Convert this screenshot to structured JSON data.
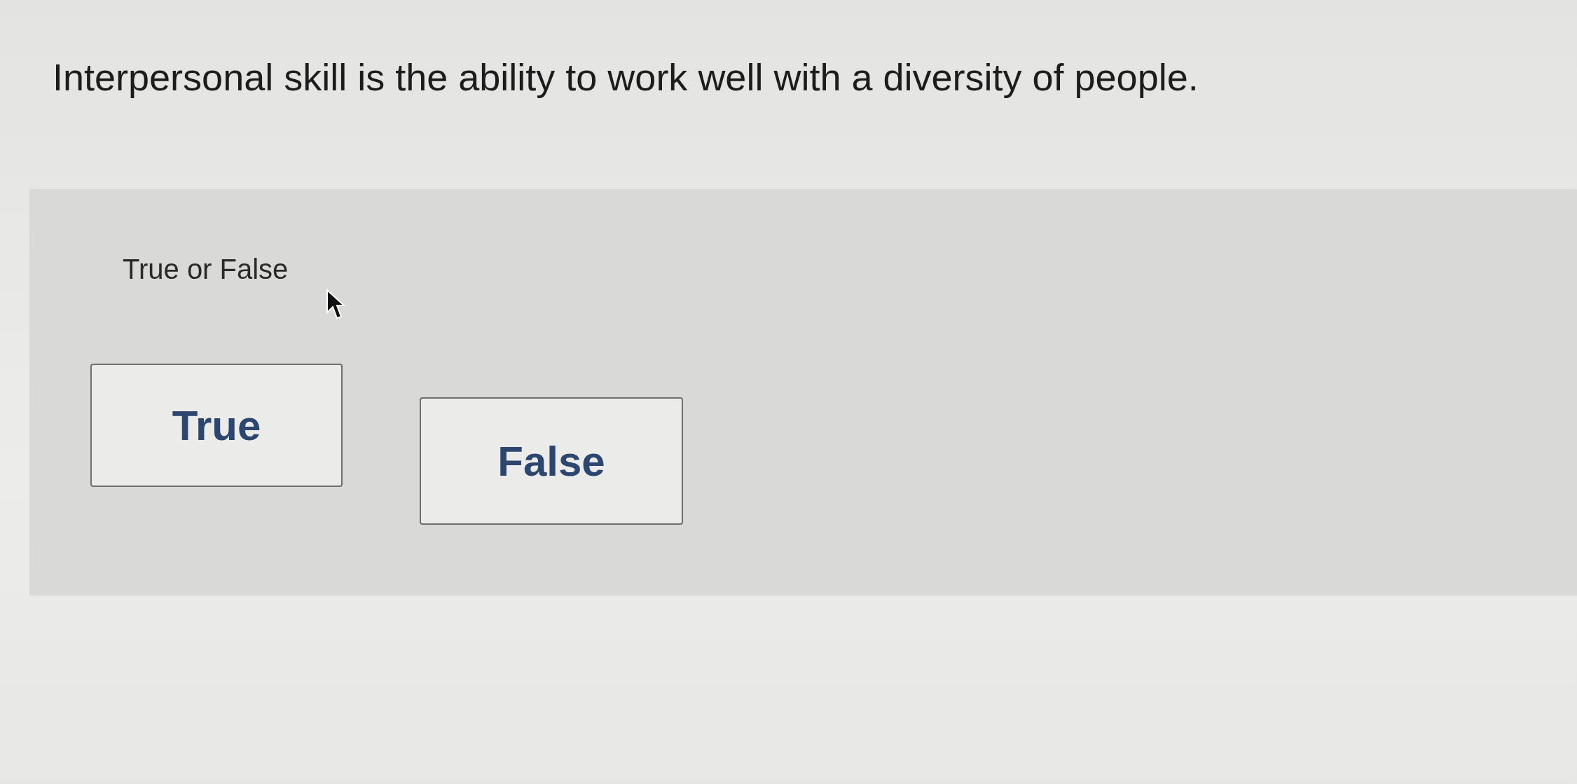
{
  "question": {
    "text": "Interpersonal skill is the ability to work well with a diversity of people."
  },
  "answer_panel": {
    "prompt": "True or False",
    "options": [
      {
        "label": "True",
        "selected": false
      },
      {
        "label": "False",
        "selected": false
      }
    ]
  }
}
